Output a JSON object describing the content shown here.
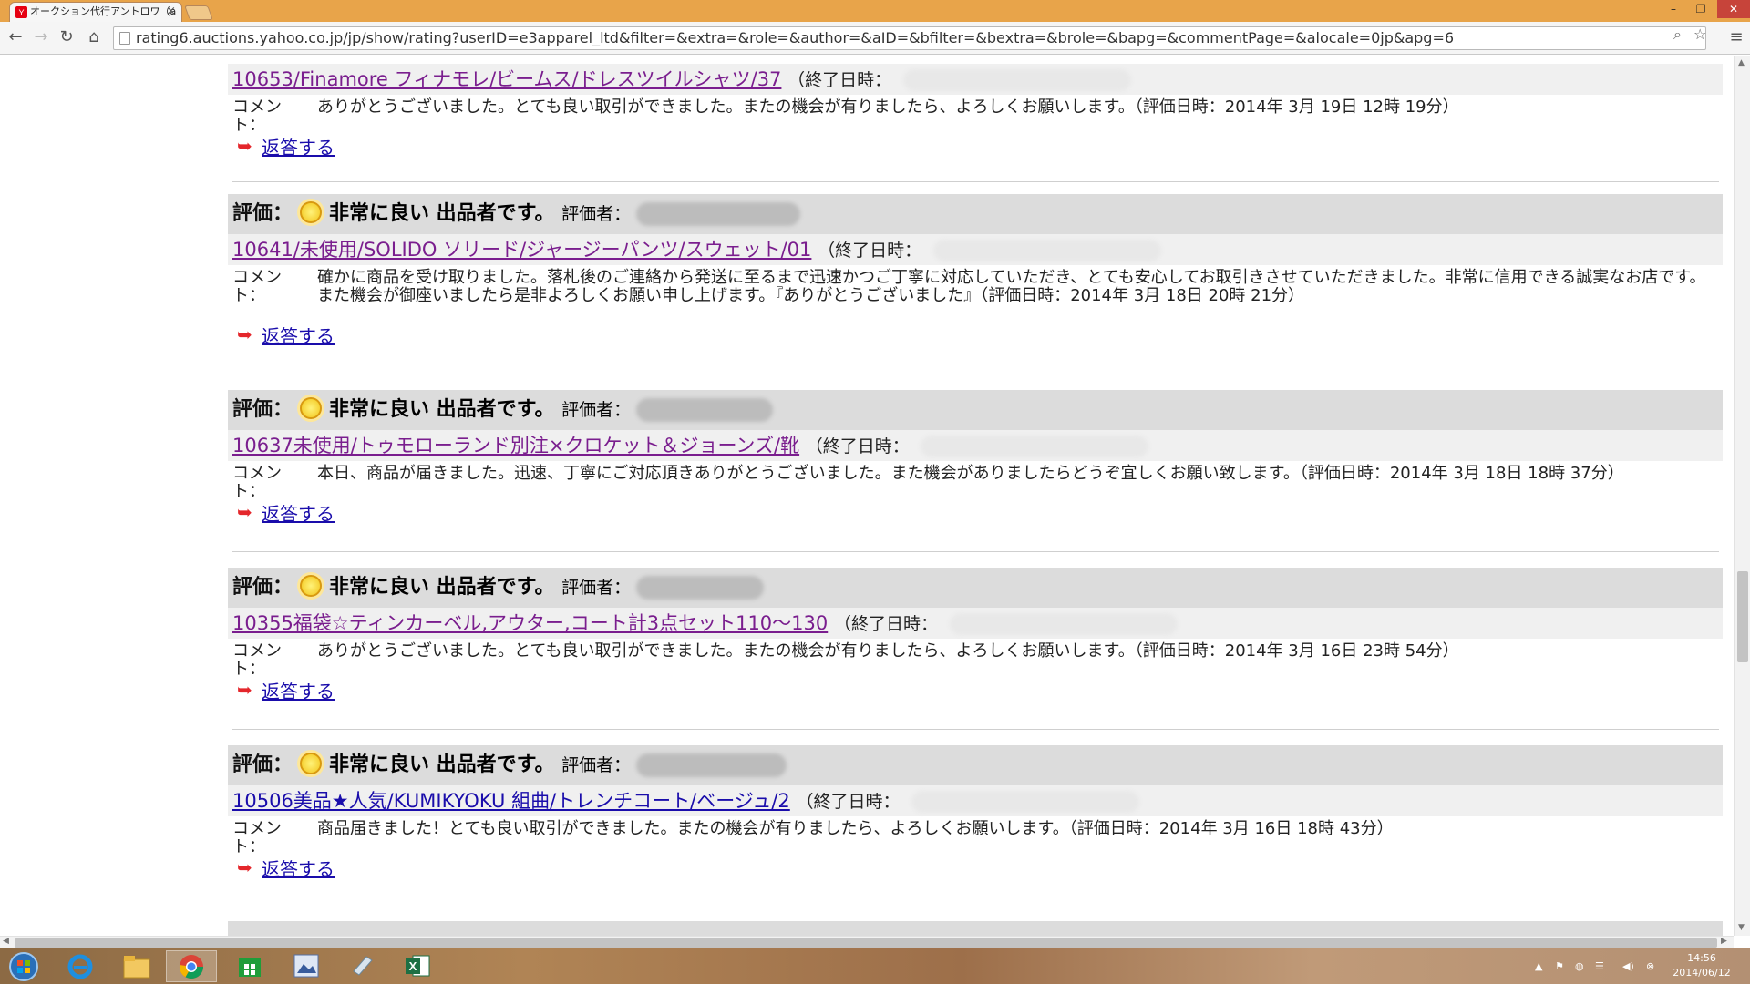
{
  "browser": {
    "tab_title": "オークション代行アントロワ（a",
    "tab_close": "×",
    "url": "rating6.auctions.yahoo.co.jp/jp/show/rating?userID=e3apparel_ltd&filter=&extra=&role=&author=&aID=&bfilter=&bextra=&brole=&bapg=&commentPage=&alocale=0jp&apg=6",
    "window_controls": [
      "–",
      "❐",
      "✕"
    ]
  },
  "labels": {
    "rating": "評価：",
    "rater": "評価者：",
    "end_time": "（終了日時：",
    "comment": "コメント：",
    "reply": "返答する",
    "reply_arrow": "➥"
  },
  "entries": [
    {
      "rating": "",
      "title": "10653/Finamore フィナモレ/ビームス/ドレスツイルシャツ/37",
      "comment": "ありがとうございました。とても良い取引ができました。またの機会が有りましたら、よろしくお願いします。（評価日時：2014年 3月 19日 12時 19分）"
    },
    {
      "rating": "非常に良い 出品者です。",
      "title": "10641/未使用/SOLIDO ソリード/ジャージーパンツ/スウェット/01",
      "comment": "確かに商品を受け取りました。落札後のご連絡から発送に至るまで迅速かつご丁寧に対応していただき、とても安心してお取引きさせていただきました。非常に信用できる誠実なお店です。また機会が御座いましたら是非よろしくお願い申し上げます。『ありがとうございました』（評価日時：2014年 3月 18日 20時 21分）"
    },
    {
      "rating": "非常に良い 出品者です。",
      "title": "10637未使用/トゥモローランド別注×クロケット＆ジョーンズ/靴",
      "comment": "本日、商品が届きました。迅速、丁寧にご対応頂きありがとうございました。また機会がありましたらどうぞ宜しくお願い致します。（評価日時：2014年 3月 18日 18時 37分）"
    },
    {
      "rating": "非常に良い 出品者です。",
      "title": "10355福袋☆ティンカーベル,アウター,コート計3点セット110〜130",
      "comment": "ありがとうございました。とても良い取引ができました。またの機会が有りましたら、よろしくお願いします。（評価日時：2014年 3月 16日 23時 54分）"
    },
    {
      "rating": "非常に良い 出品者です。",
      "title": "10506美品★人気/KUMIKYOKU 組曲/トレンチコート/ベージュ/2",
      "comment": "商品届きました！とても良い取引ができました。またの機会が有りましたら、よろしくお願いします。（評価日時：2014年 3月 16日 18時 43分）"
    }
  ],
  "taskbar": {
    "clock_time": "14:56",
    "clock_date": "2014/06/12"
  }
}
